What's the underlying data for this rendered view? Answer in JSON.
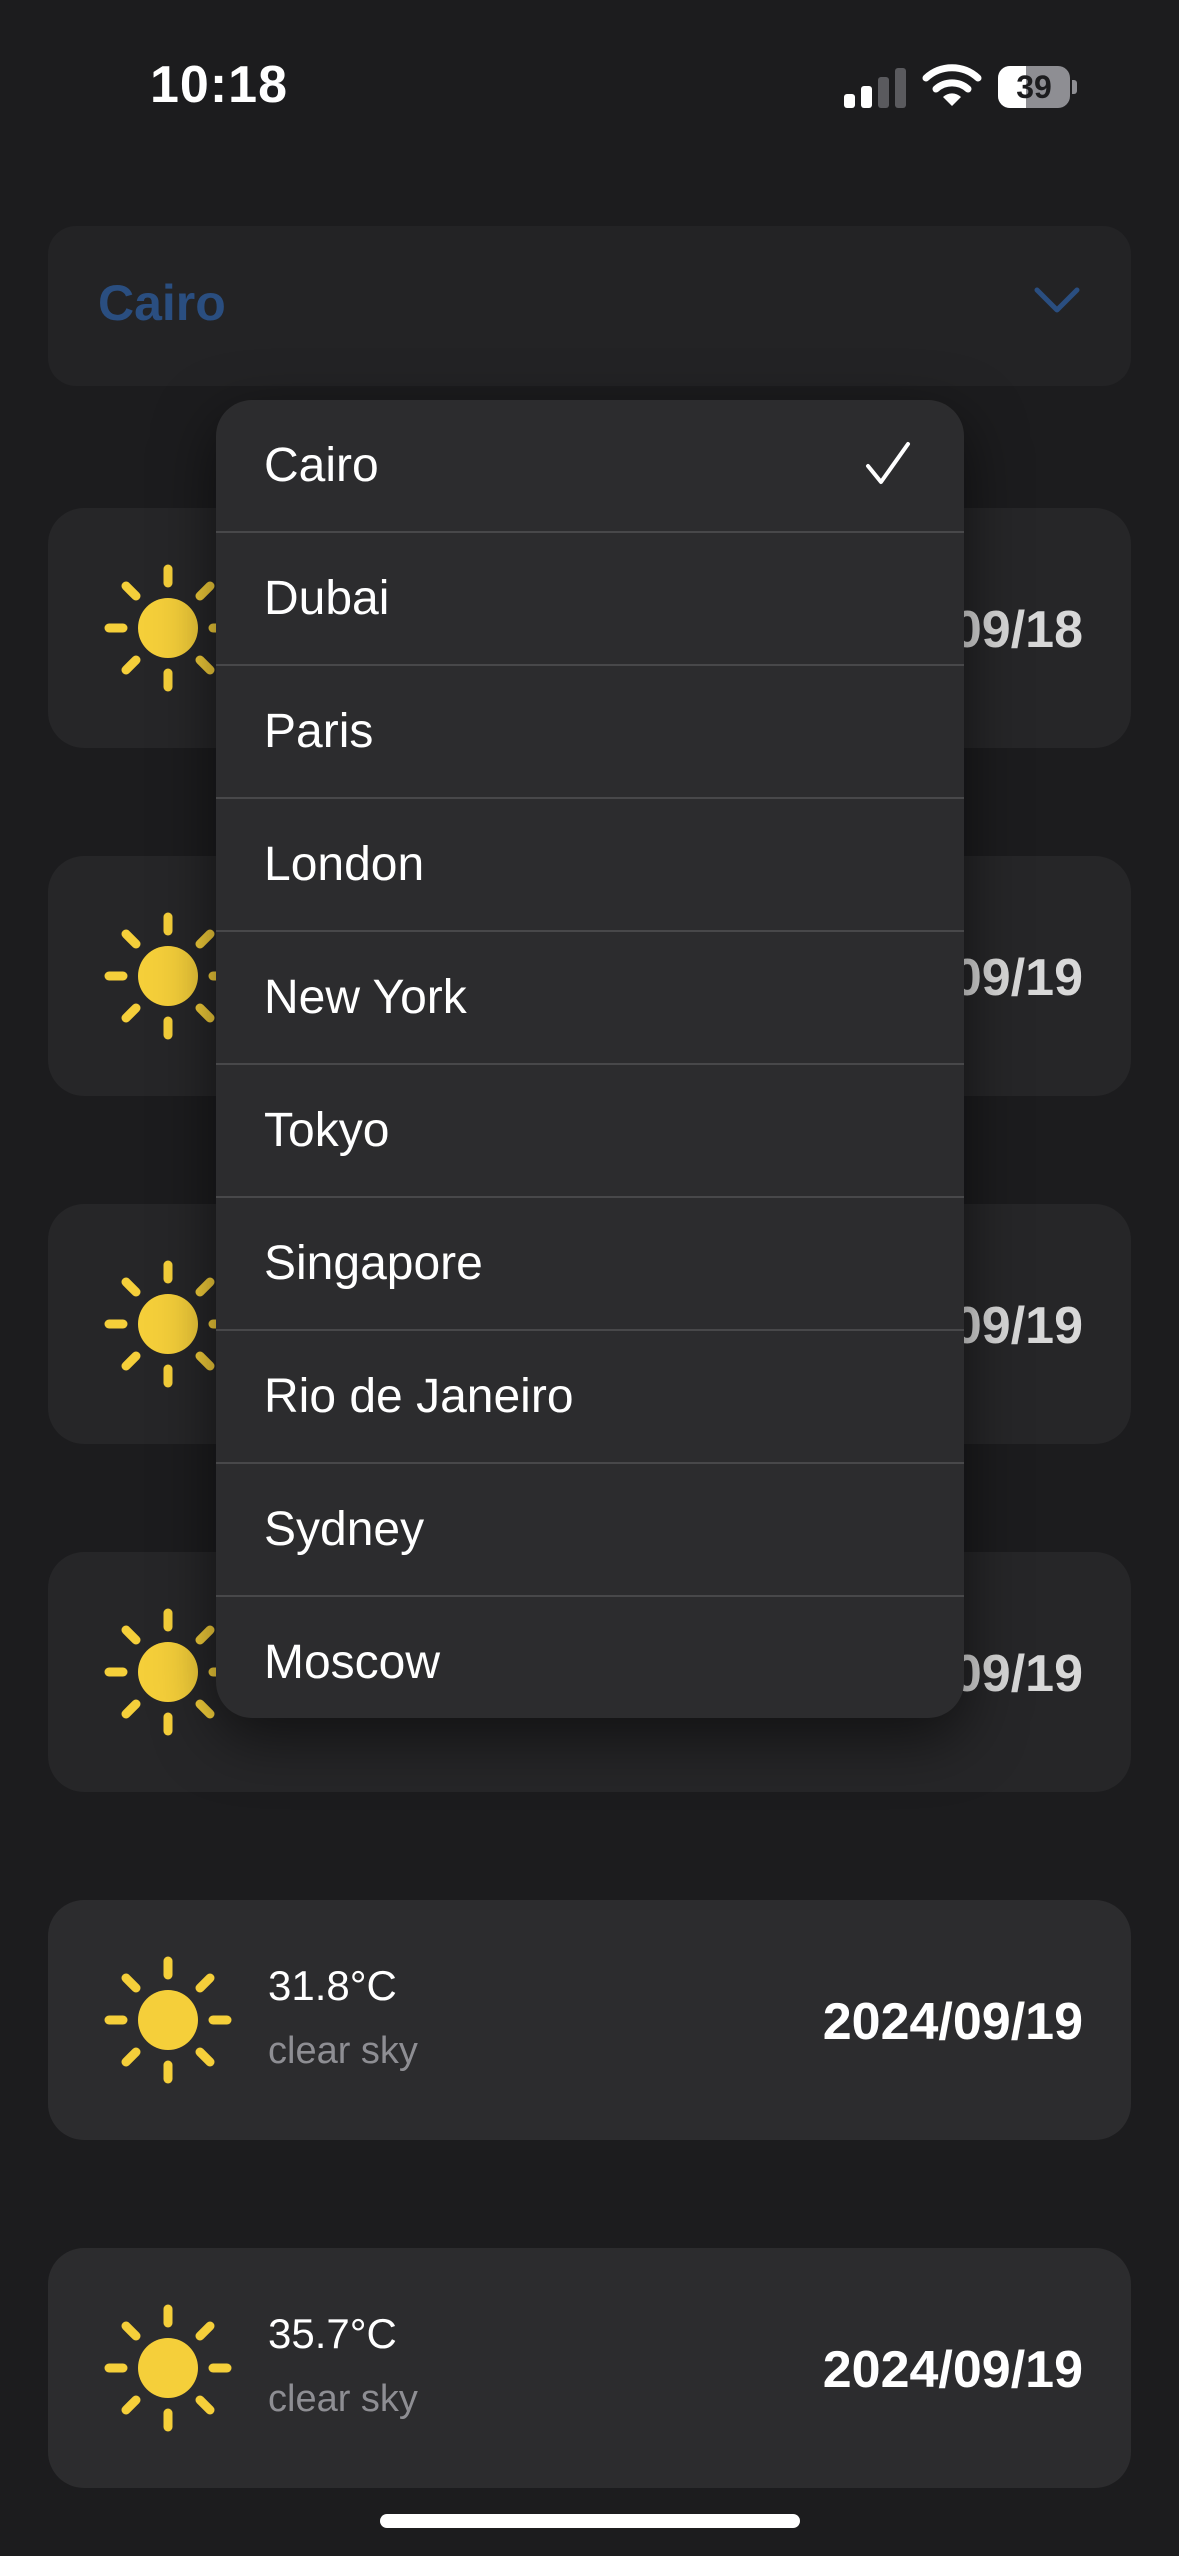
{
  "status_bar": {
    "time": "10:18",
    "battery_level": "39",
    "battery_fraction": 0.39,
    "cell_icon": "cellular-signal-icon",
    "wifi_icon": "wifi-icon"
  },
  "city_selector": {
    "selected": "Cairo",
    "chevron_icon": "chevron-down-icon"
  },
  "forecast": [
    {
      "temp": "",
      "condition": "",
      "date": "09/18"
    },
    {
      "temp": "",
      "condition": "",
      "date": "09/19"
    },
    {
      "temp": "",
      "condition": "",
      "date": "09/19"
    },
    {
      "temp": "",
      "condition": "",
      "date": "09/19"
    },
    {
      "temp": "31.8°C",
      "condition": "clear sky",
      "date": "2024/09/19"
    },
    {
      "temp": "35.7°C",
      "condition": "clear sky",
      "date": "2024/09/19"
    }
  ],
  "menu": {
    "items": [
      {
        "label": "Cairo",
        "checked": true
      },
      {
        "label": "Dubai",
        "checked": false
      },
      {
        "label": "Paris",
        "checked": false
      },
      {
        "label": "London",
        "checked": false
      },
      {
        "label": "New York",
        "checked": false
      },
      {
        "label": "Tokyo",
        "checked": false
      },
      {
        "label": "Singapore",
        "checked": false
      },
      {
        "label": "Rio de Janeiro",
        "checked": false
      },
      {
        "label": "Sydney",
        "checked": false
      },
      {
        "label": "Moscow",
        "checked": false
      }
    ],
    "check_icon": "checkmark-icon"
  },
  "colors": {
    "background": "#1c1c1e",
    "card": "#2c2c2e",
    "menu": "#2c2c2e",
    "sun": "#f5cf3a",
    "accent": "#2a4e80",
    "secondary_text": "#8e8e93"
  }
}
